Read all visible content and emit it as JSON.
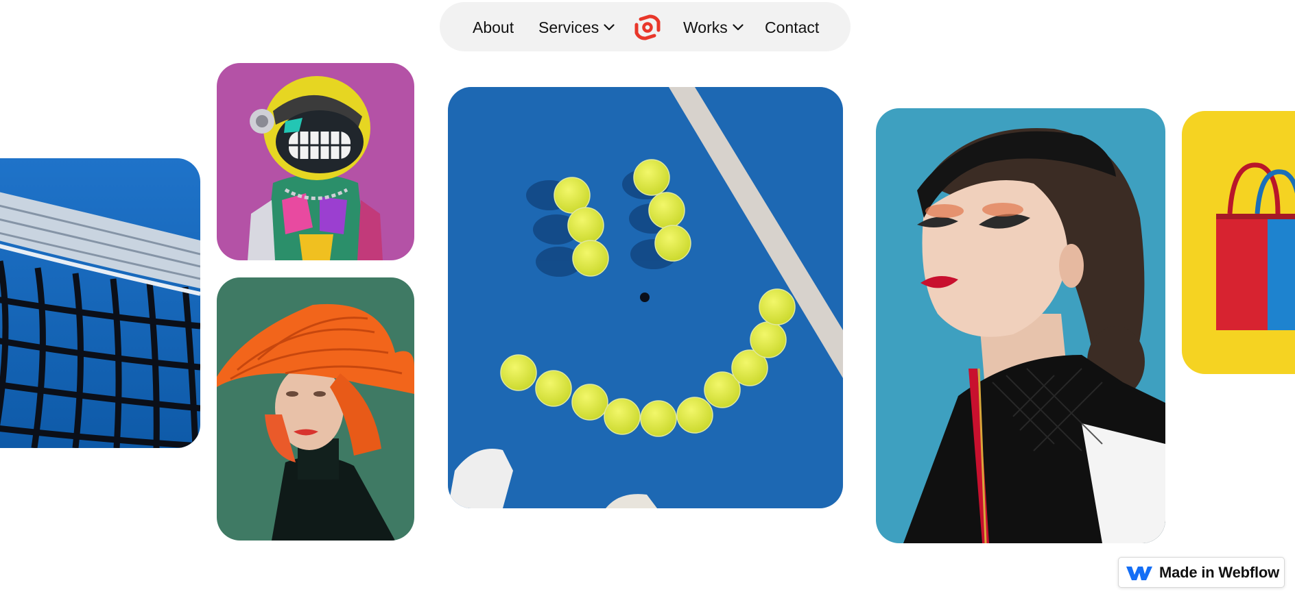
{
  "nav": {
    "items": [
      {
        "label": "About"
      },
      {
        "label": "Services",
        "has_dropdown": true
      },
      {
        "label": "Works",
        "has_dropdown": true
      },
      {
        "label": "Contact"
      }
    ],
    "logo_icon": "camera-lens-logo-icon",
    "logo_color": "#e8372a",
    "background": "#f2f2f2"
  },
  "gallery": {
    "images": [
      {
        "name": "tennis-net-photo",
        "subject": "tennis net on blue court"
      },
      {
        "name": "robot-astronaut-photo",
        "subject": "colorful graffiti robot with helmet on magenta background"
      },
      {
        "name": "orange-hat-woman-photo",
        "subject": "woman in orange pleated hat on green background"
      },
      {
        "name": "tennis-ball-smiley-photo",
        "subject": "tennis balls arranged as smiley face on blue court"
      },
      {
        "name": "fashion-portrait-photo",
        "subject": "woman with red lips and black headband on teal background"
      },
      {
        "name": "shopping-bag-photo",
        "subject": "red and blue shopping bag on yellow background"
      }
    ]
  },
  "badge": {
    "label": "Made in Webflow",
    "icon": "webflow-logo-icon",
    "icon_color": "#146ef5"
  }
}
